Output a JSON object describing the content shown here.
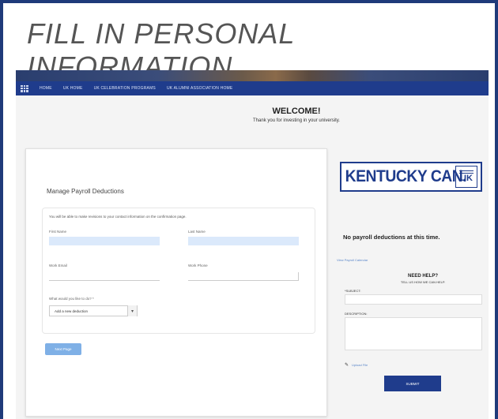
{
  "frame_title": "FILL IN PERSONAL INFORMATION",
  "nav": {
    "links": [
      "HOME",
      "UK HOME",
      "UK CELEBRATION PROGRAMS",
      "UK ALUMNI ASSOCIATION HOME"
    ]
  },
  "welcome": {
    "title": "WELCOME!",
    "subtitle": "Thank you for investing in your university."
  },
  "form": {
    "heading": "Manage Payroll Deductions",
    "note": "You will be able to make revisions to your contact information on the confirmation page.",
    "first_name_label": "First Name",
    "last_name_label": "Last Name",
    "work_email_label": "Work Email",
    "work_phone_label": "Work Phone",
    "question_label": "What would you like to do? *",
    "action_value": "Add a new deduction",
    "next_label": "Next Page"
  },
  "sidebar": {
    "logo_text": "KENTUCKY CAN.",
    "logo_badge": "UK",
    "no_deductions": "No payroll deductions at this time.",
    "view_history": "View Payroll Calendar",
    "help_title": "NEED HELP?",
    "help_sub": "TELL US HOW WE CAN HELP.",
    "subject_label": "*SUBJECT:",
    "description_label": "DESCRIPTION:",
    "upload_label": "Upload File",
    "submit_label": "SUBMIT"
  }
}
